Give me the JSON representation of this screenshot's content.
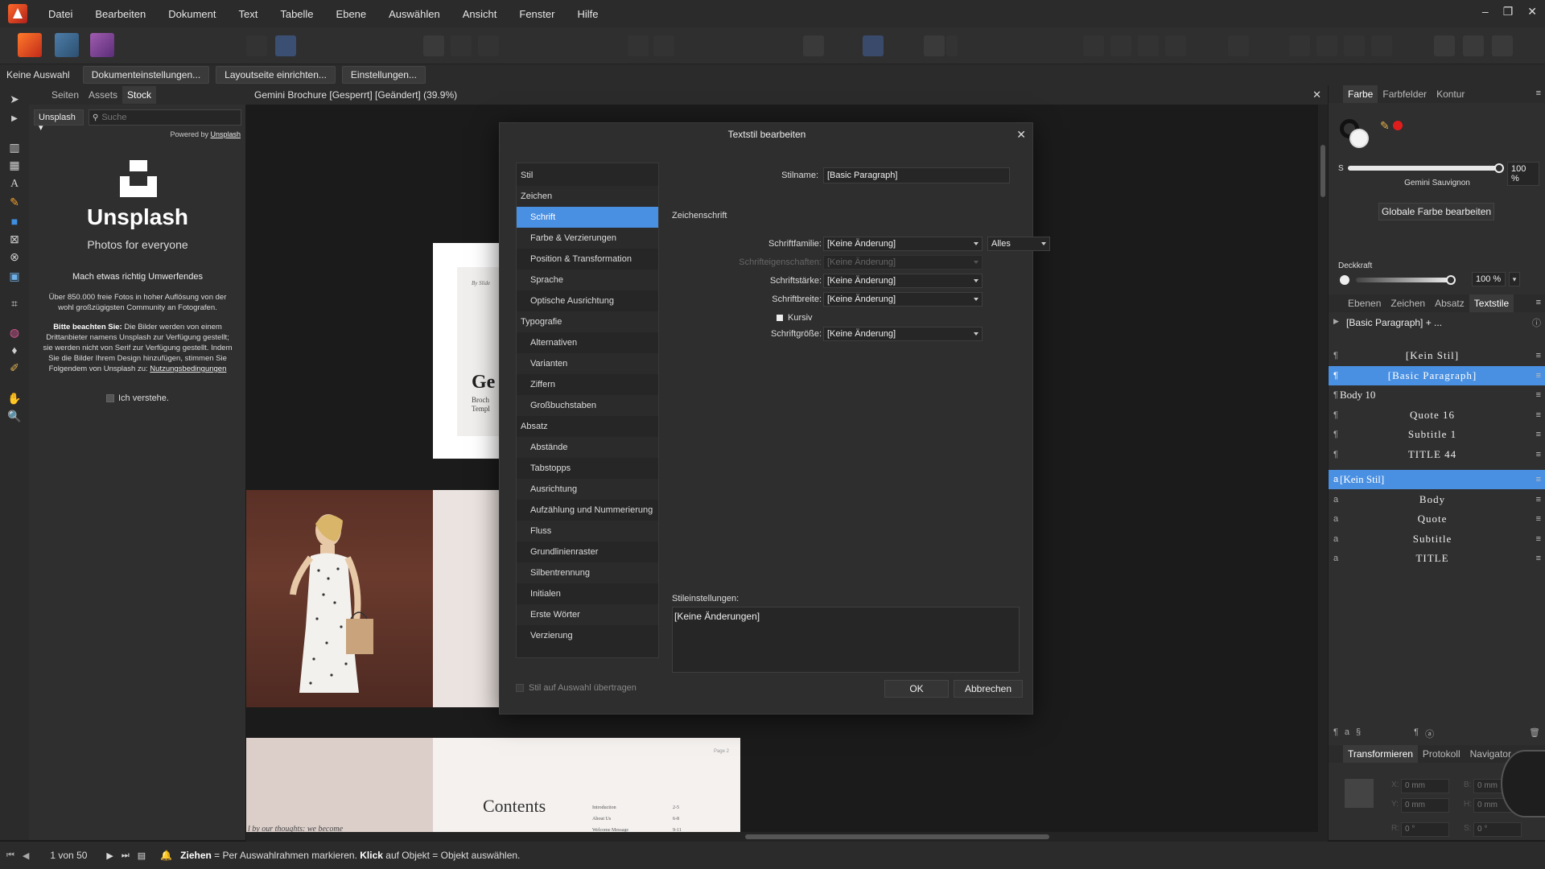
{
  "menu": [
    "Datei",
    "Bearbeiten",
    "Dokument",
    "Text",
    "Tabelle",
    "Ebene",
    "Auswählen",
    "Ansicht",
    "Fenster",
    "Hilfe"
  ],
  "window_controls": [
    "–",
    "❐",
    "✕"
  ],
  "context_bar": {
    "selection": "Keine Auswahl",
    "buttons": [
      "Dokumenteinstellungen...",
      "Layoutseite einrichten...",
      "Einstellungen..."
    ]
  },
  "stock_panel": {
    "tabs": [
      "Seiten",
      "Assets",
      "Stock"
    ],
    "active_tab": "Stock",
    "provider": "Unsplash",
    "search_placeholder": "Suche",
    "powered_by_prefix": "Powered by ",
    "powered_by_link": "Unsplash",
    "logo_text": "Unsplash",
    "tagline": "Photos for everyone",
    "heading": "Mach etwas richtig Umwerfendes",
    "description": "Über 850.000 freie Fotos in hoher Auflösung von der wohl großzügigsten Community an Fotografen.",
    "note_bold": "Bitte beachten Sie:",
    "note_text": " Die Bilder werden von einem Drittanbieter namens Unsplash zur Verfügung gestellt; sie werden nicht von Serif zur Verfügung gestellt. Indem Sie die Bilder Ihrem Design hinzufügen, stimmen Sie Folgendem von Unsplash zu: ",
    "note_link": "Nutzungsbedingungen",
    "understand_label": "Ich verstehe."
  },
  "document": {
    "title": "Gemini Brochure [Gesperrt] [Geändert] (39.9%)",
    "cover_by": "By Slide",
    "cover_title": "Ge",
    "cover_sub1": "Broch",
    "cover_sub2": "Templ",
    "contents_title": "Contents",
    "contents_page_label": "Page 2",
    "contents_quote": "l by our thoughts: we become",
    "toc_items": [
      "Introduction",
      "About Us",
      "Welcome Message"
    ],
    "toc_pages": [
      "2-5",
      "6-8",
      "9-11"
    ]
  },
  "dialog": {
    "title": "Textstil bearbeiten",
    "nav": [
      {
        "label": "Stil",
        "type": "group"
      },
      {
        "label": "Zeichen",
        "type": "group"
      },
      {
        "label": "Schrift",
        "type": "sub",
        "selected": true
      },
      {
        "label": "Farbe & Verzierungen",
        "type": "sub"
      },
      {
        "label": "Position & Transformation",
        "type": "sub"
      },
      {
        "label": "Sprache",
        "type": "sub"
      },
      {
        "label": "Optische Ausrichtung",
        "type": "sub"
      },
      {
        "label": "Typografie",
        "type": "group"
      },
      {
        "label": "Alternativen",
        "type": "sub"
      },
      {
        "label": "Varianten",
        "type": "sub"
      },
      {
        "label": "Ziffern",
        "type": "sub"
      },
      {
        "label": "Großbuchstaben",
        "type": "sub"
      },
      {
        "label": "Absatz",
        "type": "group"
      },
      {
        "label": "Abstände",
        "type": "sub"
      },
      {
        "label": "Tabstopps",
        "type": "sub"
      },
      {
        "label": "Ausrichtung",
        "type": "sub"
      },
      {
        "label": "Aufzählung und Nummerierung",
        "type": "sub"
      },
      {
        "label": "Fluss",
        "type": "sub"
      },
      {
        "label": "Grundlinienraster",
        "type": "sub"
      },
      {
        "label": "Silbentrennung",
        "type": "sub"
      },
      {
        "label": "Initialen",
        "type": "sub"
      },
      {
        "label": "Erste Wörter",
        "type": "sub"
      },
      {
        "label": "Verzierung",
        "type": "sub"
      }
    ],
    "style_name_label": "Stilname:",
    "style_name_value": "[Basic Paragraph]",
    "section_title": "Zeichenschrift",
    "font_family_label": "Schriftfamilie:",
    "font_family_value": "[Keine Änderung]",
    "font_family_scope": "Alles",
    "font_traits_label": "Schrifteigenschaften:",
    "font_traits_value": "[Keine Änderung]",
    "font_weight_label": "Schriftstärke:",
    "font_weight_value": "[Keine Änderung]",
    "font_width_label": "Schriftbreite:",
    "font_width_value": "[Keine Änderung]",
    "italic_label": "Kursiv",
    "font_size_label": "Schriftgröße:",
    "font_size_value": "[Keine Änderung]",
    "style_settings_label": "Stileinstellungen:",
    "style_settings_value": "[Keine Änderungen]",
    "apply_label": "Stil auf Auswahl übertragen",
    "ok_label": "OK",
    "cancel_label": "Abbrechen"
  },
  "color_panel": {
    "tabs": [
      "Farbe",
      "Farbfelder",
      "Kontur"
    ],
    "active_tab": "Farbe",
    "s_label": "S",
    "s_value": "100 %",
    "s_level": 1.0,
    "color_name": "Gemini Sauvignon",
    "global_button": "Globale Farbe bearbeiten",
    "opacity_label": "Deckkraft",
    "opacity_value": "100 %",
    "opacity_level": 1.0,
    "accent": "#e01d1d"
  },
  "styles_panel": {
    "tabs": [
      "Ebenen",
      "Zeichen",
      "Absatz",
      "Textstile"
    ],
    "active_tab": "Textstile",
    "group_header": "[Basic Paragraph] + ...",
    "paragraph_styles": [
      {
        "icon": "¶",
        "name": "[Kein Stil]",
        "selected": false
      },
      {
        "icon": "¶",
        "name": "[Basic Paragraph]",
        "selected": true
      },
      {
        "icon": "¶",
        "name": "Body 10",
        "selected": false
      },
      {
        "icon": "¶",
        "name": "Quote 16",
        "selected": false
      },
      {
        "icon": "¶",
        "name": "Subtitle 1",
        "selected": false
      },
      {
        "icon": "¶",
        "name": "TITLE 44",
        "selected": false
      }
    ],
    "character_styles": [
      {
        "icon": "a",
        "name": "[Kein Stil]",
        "selected": true
      },
      {
        "icon": "a",
        "name": "Body",
        "selected": false
      },
      {
        "icon": "a",
        "name": "Quote",
        "selected": false
      },
      {
        "icon": "a",
        "name": "Subtitle",
        "selected": false
      },
      {
        "icon": "a",
        "name": "TITLE",
        "selected": false
      }
    ]
  },
  "transform_panel": {
    "tabs": [
      "Transformieren",
      "Protokoll",
      "Navigator"
    ],
    "active_tab": "Transformieren",
    "x_label": "X:",
    "y_label": "Y:",
    "x_value": "0 mm",
    "y_value": "0 mm",
    "w_label": "B:",
    "h_label": "H:",
    "w_value": "0 mm",
    "h_value": "0 mm",
    "r_label": "R:",
    "s_label": "S:",
    "r_value": "0 °",
    "s_value": "0 °"
  },
  "status_bar": {
    "page_info": "1 von 50",
    "hint_drag": "Ziehen",
    "hint_drag_text": " = Per Auswahlrahmen markieren. ",
    "hint_click": "Klick",
    "hint_click_text": " auf Objekt = Objekt auswählen."
  }
}
